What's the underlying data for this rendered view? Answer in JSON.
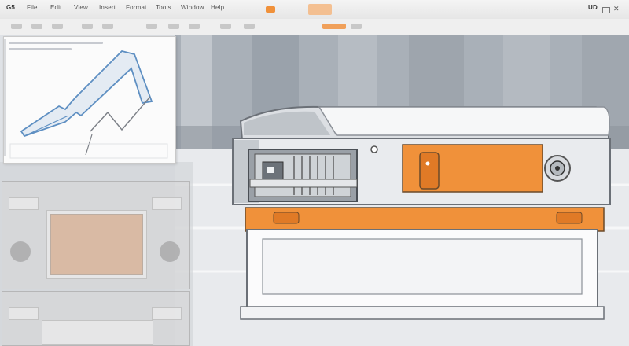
{
  "menubar": {
    "logo": "G5",
    "items": [
      "File",
      "Edit",
      "View",
      "Insert",
      "Format",
      "Tools",
      "Window",
      "Help"
    ],
    "right_label": "UD"
  },
  "sketch_panel": {
    "title": ""
  },
  "ghost_panel_top": {
    "label": "",
    "side_label": ""
  },
  "ghost_panel_bottom": {
    "label": "",
    "side_label": ""
  },
  "colors": {
    "accent": "#f0913a",
    "machine_body": "#e9ebee",
    "metal": "#8c9198"
  }
}
